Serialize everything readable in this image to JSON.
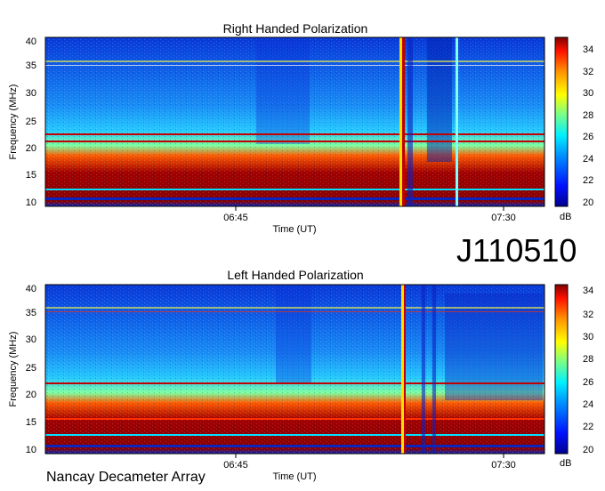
{
  "page": {
    "observation_id": "J110510",
    "instrument": "Nancay Decameter Array"
  },
  "colors": {
    "background_low": "#0a2fd8",
    "background_mid": "#1f8ef0",
    "emission_high": "#8b0000",
    "colorbar_stops": [
      "#000090",
      "#0010ff",
      "#0090ff",
      "#00f0ff",
      "#80ff80",
      "#ffff00",
      "#ff9000",
      "#ff1000",
      "#800000"
    ]
  },
  "chart_data": [
    {
      "type": "heatmap",
      "title": "Right Handed Polarization",
      "xlabel": "Time (UT)",
      "ylabel": "Frequency (MHz)",
      "x_ticks": [
        "06:45",
        "07:30"
      ],
      "y_ticks": [
        10,
        15,
        20,
        25,
        30,
        35,
        40
      ],
      "ylim": [
        10,
        40
      ],
      "colorbar": {
        "label": "dB",
        "ticks": [
          20,
          22,
          24,
          26,
          28,
          30,
          32,
          34
        ],
        "range": [
          20,
          35
        ]
      },
      "features": {
        "strong_bands_mhz": [
          [
            11,
            19
          ]
        ],
        "moderate_band_mhz": [
          19,
          24
        ],
        "vertical_bursts_frac": [
          0.71,
          0.77,
          0.81
        ]
      }
    },
    {
      "type": "heatmap",
      "title": "Left Handed Polarization",
      "xlabel": "Time (UT)",
      "ylabel": "Frequency (MHz)",
      "x_ticks": [
        "06:45",
        "07:30"
      ],
      "y_ticks": [
        10,
        15,
        20,
        25,
        30,
        35,
        40
      ],
      "ylim": [
        10,
        40
      ],
      "colorbar": {
        "label": "dB",
        "ticks": [
          20,
          22,
          24,
          26,
          28,
          30,
          32,
          34
        ],
        "range": [
          20,
          35
        ]
      },
      "features": {
        "strong_bands_mhz": [
          [
            11,
            19
          ]
        ],
        "moderate_band_mhz": [
          19,
          24
        ],
        "vertical_bursts_frac": [
          0.71,
          0.77
        ]
      }
    }
  ]
}
